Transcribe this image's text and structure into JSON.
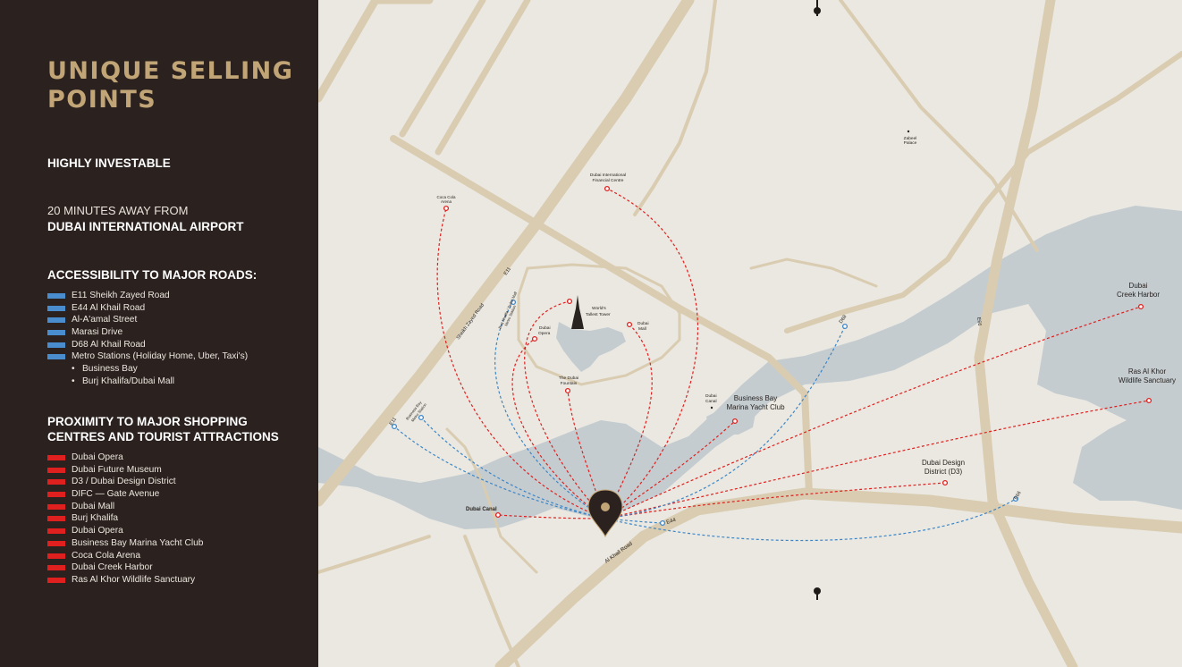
{
  "sidebar": {
    "title_line1": "UNIQUE SELLING",
    "title_line2": "POINTS",
    "highly_investable": "HIGHLY INVESTABLE",
    "airport_prefix": "20 MINUTES AWAY FROM",
    "airport_name": "DUBAI INTERNATIONAL AIRPORT",
    "roads_heading": "ACCESSIBILITY TO MAJOR ROADS:",
    "roads": [
      "E11 Sheikh Zayed Road",
      "E44 Al Khail Road",
      "Al-A'amal Street",
      "Marasi Drive",
      "D68 Al Khail Road",
      "Metro Stations (Holiday Home, Uber, Taxi's)"
    ],
    "metro_stations": [
      "Business Bay",
      "Burj Khalifa/Dubai Mall"
    ],
    "attractions_heading_line1": "PROXIMITY TO MAJOR SHOPPING",
    "attractions_heading_line2": "CENTRES AND TOURIST ATTRACTIONS",
    "attractions": [
      "Dubai Opera",
      "Dubai Future Museum",
      "D3 / Dubai Design District",
      "DIFC — Gate Avenue",
      "Dubai Mall",
      "Burj Khalifa",
      "Dubai Opera",
      "Business Bay Marina Yacht Club",
      "Coca Cola Arena",
      "Dubai Creek Harbor",
      "Ras Al Khor Wildlife Sanctuary"
    ]
  },
  "colors": {
    "road_swatch": "#4a8dcf",
    "attraction_swatch": "#e0201e",
    "title": "#c2a576",
    "sidebar_bg": "#2b221f",
    "map_bg": "#eae8e1",
    "road": "#d9ccb1",
    "water": "#c4ccd0",
    "route_red": "#e0201e",
    "route_blue": "#3c86c8"
  },
  "map": {
    "center_pin": "location-pin-icon",
    "labels": {
      "coca_cola_1": "Coca Cola",
      "coca_cola_2": "Arena",
      "difc_1": "Dubai International",
      "difc_2": "Financial Centre",
      "zabeel_1": "Zabeel",
      "zabeel_2": "Palace",
      "tallest_1": "World's",
      "tallest_2": "Tallest Tower",
      "mall_1": "Dubai",
      "mall_2": "Mall",
      "opera_1": "Dubai",
      "opera_2": "Opera",
      "fountain_1": "The Dubai",
      "fountain_2": "Fountain",
      "canal_small_1": "Dubai",
      "canal_small_2": "Canal",
      "bbmyc_1": "Business Bay",
      "bbmyc_2": "Marina Yacht Club",
      "creek_1": "Dubai",
      "creek_2": "Creek Harbor",
      "ras_1": "Ras Al Khor",
      "ras_2": "Wildlife Sanctuary",
      "d3_1": "Dubai Design",
      "d3_2": "District (D3)",
      "dubai_canal": "Dubai Canal",
      "al_khail": "Al Khail Road",
      "e44": "E44",
      "e66": "E66",
      "d68": "D68",
      "e11_top": "E11",
      "e11_bottom": "E11",
      "szr": "Sheikh Zayed Road",
      "metro_bk_1": "Burj Khalifa / Dubai Mall",
      "metro_bk_2": "Metro Station",
      "metro_bb_1": "Business Bay",
      "metro_bb_2": "Metro Station",
      "e66_vertical": "E66"
    }
  }
}
